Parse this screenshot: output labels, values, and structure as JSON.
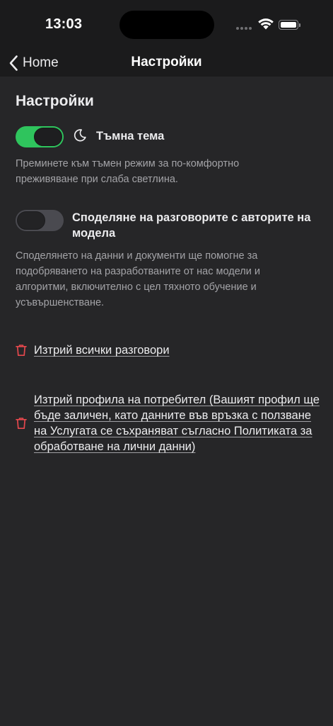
{
  "status_bar": {
    "time": "13:03",
    "battery_level": 1.0
  },
  "nav": {
    "back_label": "Home",
    "title": "Настройки"
  },
  "settings": {
    "section_title": "Настройки",
    "dark_theme": {
      "label": "Тъмна тема",
      "enabled": true,
      "description_lines": [
        "Преминете към тъмен режим за по-комфортно",
        "преживяване при слаба светлина."
      ]
    },
    "share_conversations": {
      "label_lines": [
        "Споделяне на разговорите с авторите на",
        "модела"
      ],
      "enabled": false,
      "description_lines": [
        "Споделянето на данни и документи ще помогне за",
        "подобряването на разработваните от нас модели и",
        "алгоритми, включително с цел тяхното обучение и",
        "усъвършенстване."
      ]
    },
    "delete_conversations": {
      "label": "Изтрий всички разговори"
    },
    "delete_profile": {
      "label_lines": [
        "Изтрий профила на потребител (Вашият профил ще",
        "бъде заличен, като данните във връзка с ползване",
        "на Услугата се съхраняват съгласно Политиката за",
        "обработване на лични данни)"
      ]
    }
  },
  "colors": {
    "accent_green": "#2fc45d",
    "danger_red": "#e5484d",
    "background": "#262628",
    "bar_background": "#1b1b1c"
  },
  "icons": {
    "back": "chevron-left-icon",
    "moon": "moon-icon",
    "trash": "trash-icon",
    "wifi": "wifi-icon",
    "battery": "battery-icon"
  }
}
